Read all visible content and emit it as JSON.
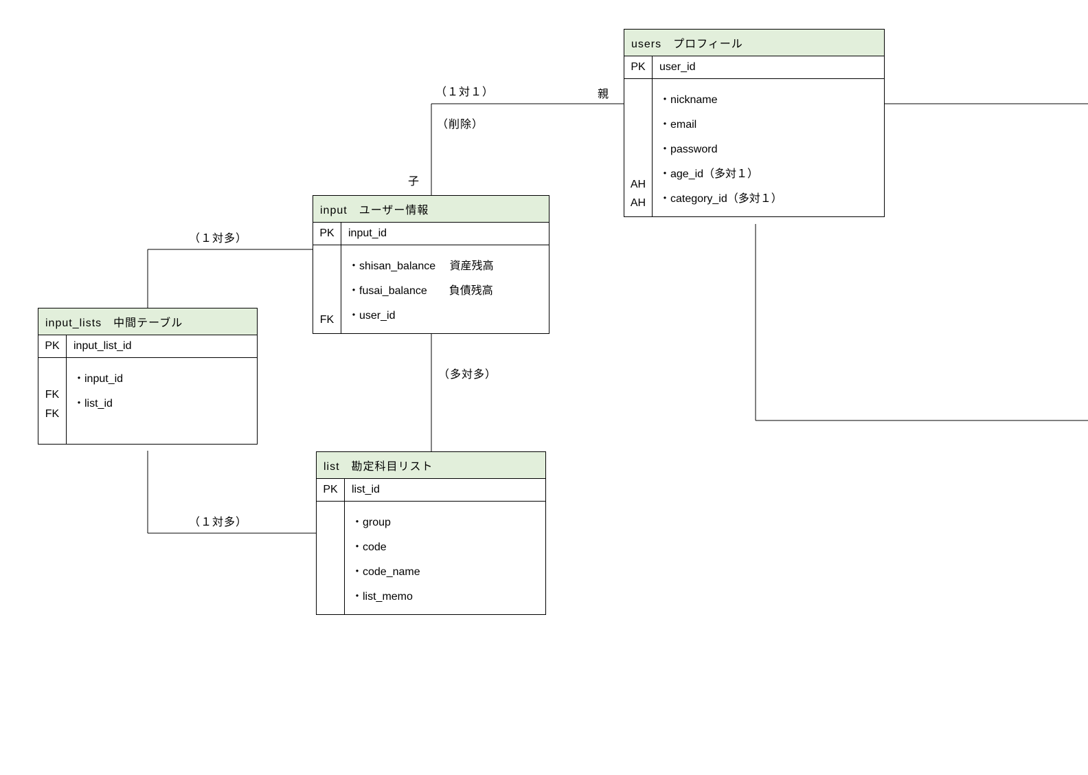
{
  "relationship_labels": {
    "one_to_one": "（１対１）",
    "parent": "親",
    "delete": "（削除）",
    "child": "子",
    "one_to_many_upper": "（１対多）",
    "many_to_many": "（多対多）",
    "one_to_many_lower": "（１対多）"
  },
  "keys": {
    "pk": "PK",
    "fk": "FK",
    "ah": "AH"
  },
  "tables": {
    "users": {
      "title": "users　プロフィール",
      "pk": "user_id",
      "fields": [
        "・nickname",
        "・email",
        "・password",
        "・age_id（多対１）",
        "・category_id（多対１）"
      ],
      "ah1": "AH",
      "ah2": "AH"
    },
    "input": {
      "title": "input　ユーザー情報",
      "pk": "input_id",
      "fields": [
        "・shisan_balance　 資産残高",
        "・fusai_balance　　負債残高",
        "・user_id"
      ],
      "body_key": "FK"
    },
    "input_lists": {
      "title": "input_lists　中間テーブル",
      "pk": "input_list_id",
      "fields": [
        "・input_id",
        "・list_id"
      ],
      "fk1": "FK",
      "fk2": "FK"
    },
    "list": {
      "title": "list　勘定科目リスト",
      "pk": "list_id",
      "fields": [
        "・group",
        "・code",
        "・code_name",
        "・list_memo"
      ]
    }
  }
}
